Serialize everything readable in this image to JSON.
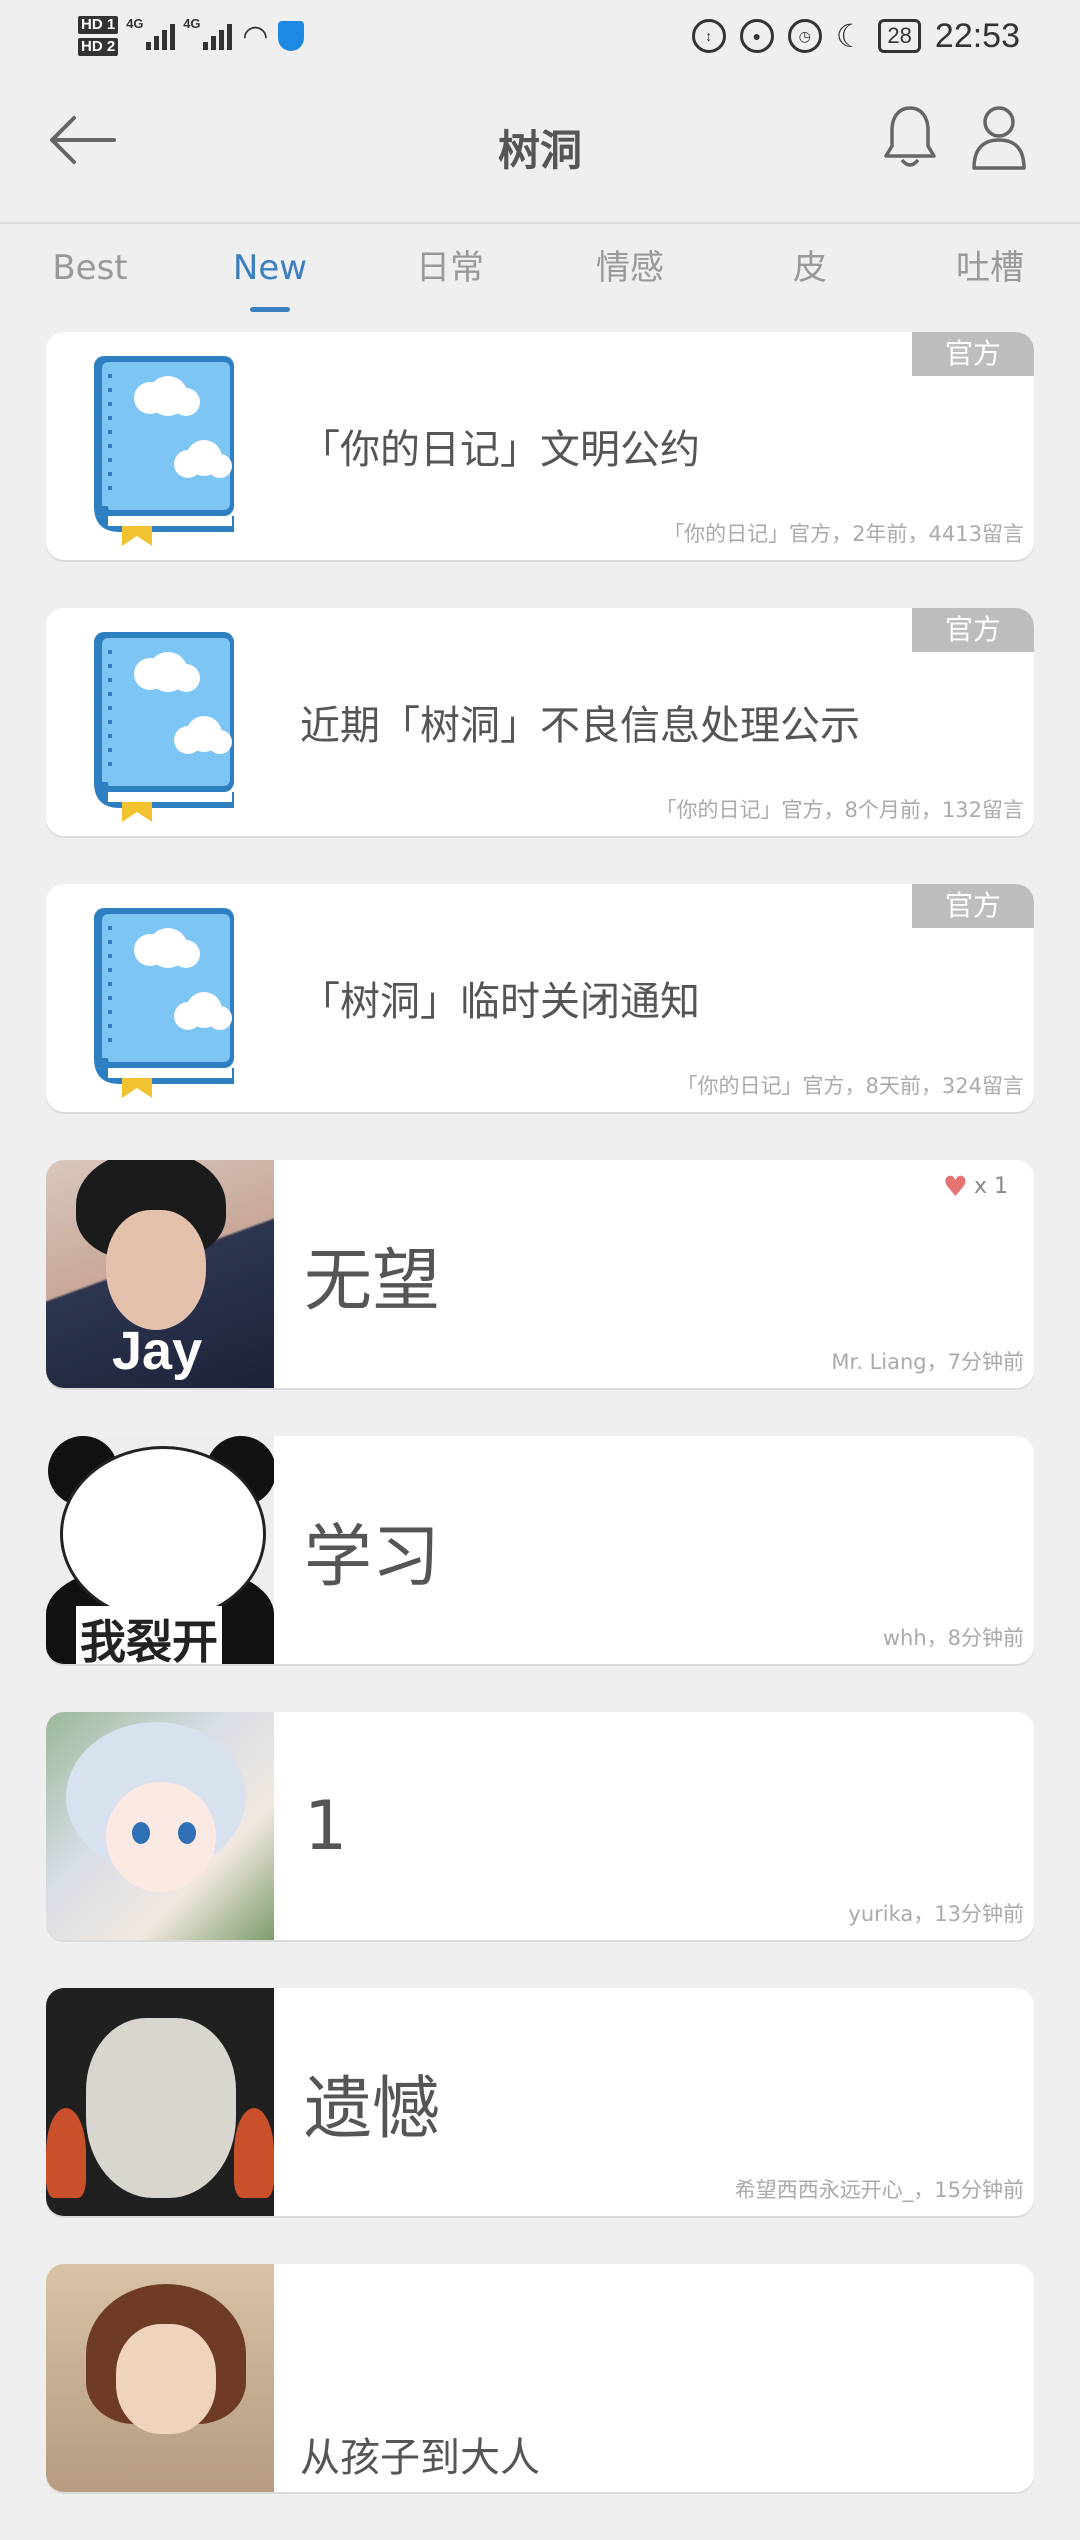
{
  "status_bar": {
    "hd1": "HD 1",
    "hd2": "HD 2",
    "net1": "4G",
    "net2": "4G",
    "battery": "28",
    "time": "22:53"
  },
  "header": {
    "title": "树洞"
  },
  "tabs": [
    "Best",
    "New",
    "日常",
    "情感",
    "皮",
    "吐槽"
  ],
  "active_tab": "New",
  "posts": [
    {
      "title": "「你的日记」文明公约",
      "meta": "「你的日记」官方，2年前，4413留言",
      "tag": "官方"
    },
    {
      "title": "近期「树洞」不良信息处理公示",
      "meta": "「你的日记」官方，8个月前，132留言",
      "tag": "官方"
    },
    {
      "title": "「树洞」临时关闭通知",
      "meta": "「你的日记」官方，8天前，324留言",
      "tag": "官方"
    },
    {
      "title": "无望",
      "meta": "Mr. Liang，7分钟前",
      "likes": "x 1",
      "avatar_text": "Jay"
    },
    {
      "title": "学习",
      "meta": "whh，8分钟前",
      "avatar_text": "我裂开"
    },
    {
      "title": "1",
      "meta": "yurika，13分钟前"
    },
    {
      "title": "遗憾",
      "meta": "希望西西永远开心_，15分钟前"
    },
    {
      "title": "从孩子到大人",
      "meta": ""
    }
  ],
  "colors": {
    "accent": "#3a7fbf",
    "tag_bg": "#bdbdbd",
    "book_blue": "#5aaee6"
  }
}
